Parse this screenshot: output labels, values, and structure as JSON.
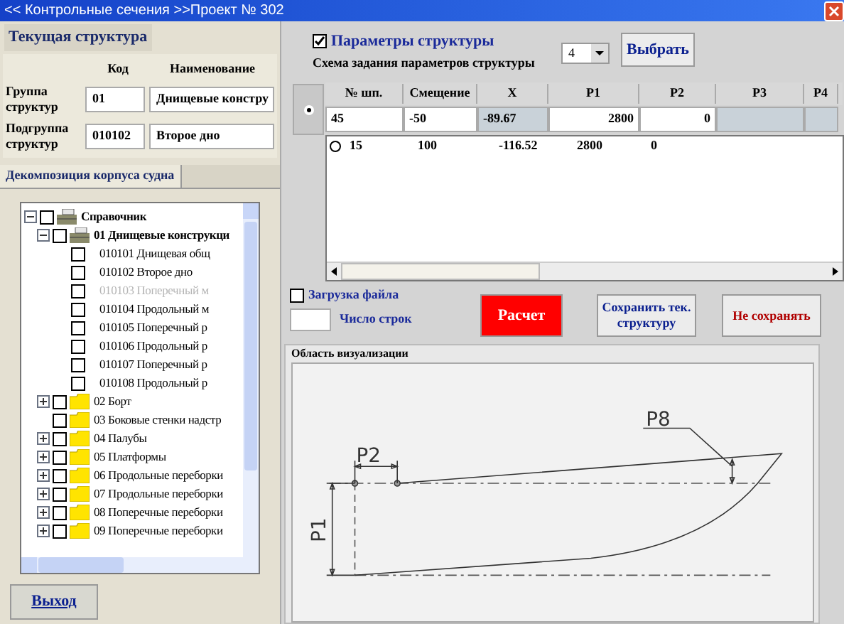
{
  "window": {
    "title": "<< Контрольные сечения >>Проект № 302"
  },
  "current_structure": {
    "title": "Текущая структура",
    "col_code": "Код",
    "col_name": "Наименование",
    "rows": [
      {
        "label": "Группа структур",
        "code": "01",
        "name": "Днищевые констру"
      },
      {
        "label": "Подгруппа структур",
        "code": "010102",
        "name": "Второе дно"
      }
    ]
  },
  "tabs": [
    {
      "label": "Декомпозиция корпуса судна",
      "selected": true
    }
  ],
  "tree": [
    {
      "label": "Справочник",
      "kind": "cabinet",
      "expanded": true,
      "checked": false,
      "disabled": false,
      "children": [
        {
          "label": "01 Днищевые конструкци",
          "kind": "cabinet",
          "expanded": true,
          "checked": false,
          "disabled": false,
          "children": [
            {
              "label": "010101 Днищевая общ",
              "kind": "leaf",
              "checked": false,
              "disabled": false
            },
            {
              "label": "010102 Второе дно",
              "kind": "leaf",
              "checked": false,
              "disabled": false
            },
            {
              "label": "010103 Поперечный м",
              "kind": "leaf",
              "checked": false,
              "disabled": true
            },
            {
              "label": "010104 Продольный м",
              "kind": "leaf",
              "checked": false,
              "disabled": false
            },
            {
              "label": "010105 Поперечный р",
              "kind": "leaf",
              "checked": false,
              "disabled": false
            },
            {
              "label": "010106 Продольный р",
              "kind": "leaf",
              "checked": false,
              "disabled": false
            },
            {
              "label": "010107 Поперечный р",
              "kind": "leaf",
              "checked": false,
              "disabled": false
            },
            {
              "label": "010108 Продольный р",
              "kind": "leaf",
              "checked": false,
              "disabled": false
            }
          ]
        },
        {
          "label": "02 Борт",
          "kind": "folder",
          "expanded": false,
          "checked": false,
          "disabled": false
        },
        {
          "label": "03 Боковые стенки надстр",
          "kind": "folder",
          "checked": false,
          "disabled": false
        },
        {
          "label": "04 Палубы",
          "kind": "folder",
          "expanded": false,
          "checked": false,
          "disabled": false
        },
        {
          "label": "05 Платформы",
          "kind": "folder",
          "expanded": false,
          "checked": false,
          "disabled": false
        },
        {
          "label": "06 Продольные переборки",
          "kind": "folder",
          "expanded": false,
          "checked": false,
          "disabled": false
        },
        {
          "label": "07 Продольные переборки",
          "kind": "folder",
          "expanded": false,
          "checked": false,
          "disabled": false
        },
        {
          "label": "08 Поперечные переборки",
          "kind": "folder",
          "expanded": false,
          "checked": false,
          "disabled": false
        },
        {
          "label": "09 Поперечные переборки",
          "kind": "folder",
          "expanded": false,
          "checked": false,
          "disabled": false
        }
      ]
    }
  ],
  "exit_button": "Выход",
  "params": {
    "label": "Параметры структуры",
    "checked": true,
    "scheme_label": "Схема задания параметров структуры",
    "scheme_value": "4",
    "select_button": "Выбрать"
  },
  "table": {
    "columns": [
      "№ шп.",
      "Смещение",
      "X",
      "P1",
      "P2",
      "P3",
      "P4"
    ],
    "edit_row": {
      "selected": true,
      "cells": [
        {
          "value": "45",
          "kind": "input"
        },
        {
          "value": "-50",
          "kind": "input"
        },
        {
          "value": "-89.67",
          "kind": "readonly"
        },
        {
          "value": "2800",
          "kind": "input"
        },
        {
          "value": "0",
          "kind": "input"
        },
        {
          "kind": "readonly"
        },
        {
          "kind": "readonly"
        }
      ]
    },
    "rows": [
      {
        "selected": false,
        "cells": [
          "15",
          "100",
          "-116.52",
          "2800",
          "0"
        ]
      }
    ]
  },
  "file_load": {
    "label": "Загрузка файла",
    "checked": false
  },
  "row_count": {
    "label": "Число строк"
  },
  "buttons": [
    {
      "label": "Расчет",
      "kind": "danger"
    },
    {
      "label": "Сохранить тек. структуру",
      "kind": "normal"
    },
    {
      "label": "Не сохранять",
      "kind": "warning"
    }
  ],
  "visualization": {
    "title": "Область визуализации",
    "labels": [
      "P2",
      "P1",
      "P8"
    ]
  }
}
